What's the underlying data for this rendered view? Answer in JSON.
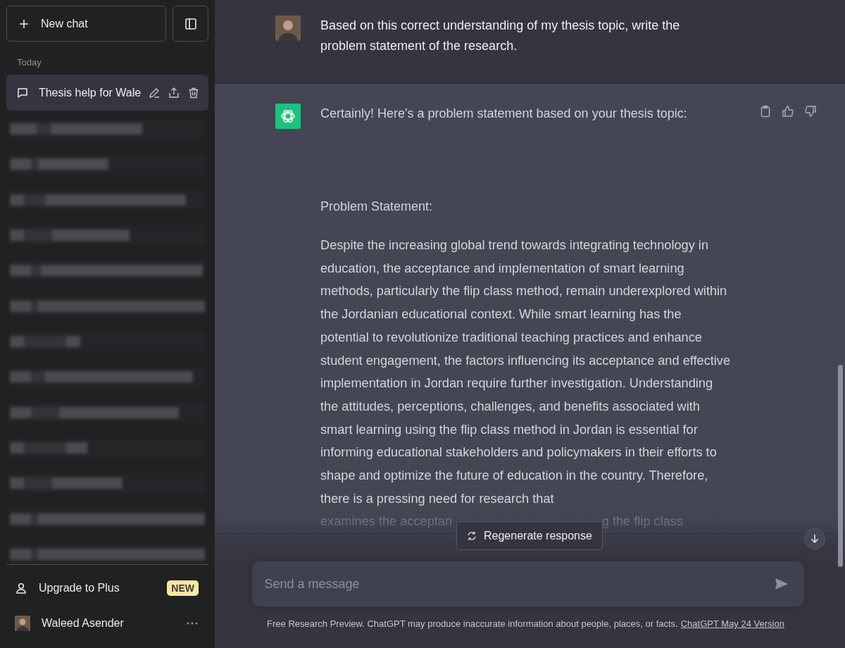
{
  "sidebar": {
    "new_chat_button": "New chat",
    "section_label": "Today",
    "conversations": [
      {
        "title": "Thesis help for Wale",
        "selected": true
      }
    ],
    "upgrade": {
      "label": "Upgrade to Plus",
      "badge": "NEW"
    },
    "user": {
      "name": "Waleed Asender"
    }
  },
  "messages": [
    {
      "kind": "user",
      "text": "Based on this correct understanding of my thesis topic, write the problem statement of the research."
    },
    {
      "kind": "assistant",
      "intro": "Certainly! Here's a problem statement based on your thesis topic:",
      "heading": "Problem Statement:",
      "paragraph": "Despite the increasing global trend towards integrating technology in education, the acceptance and implementation of smart learning methods, particularly the flip class method, remain underexplored within the Jordanian educational context. While smart learning has the potential to revolutionize traditional teaching practices and enhance student engagement, the factors influencing its acceptance and effective implementation in Jordan require further investigation. Understanding the attitudes, perceptions, challenges, and benefits associated with smart learning using the flip class method in Jordan is essential for informing educational stakeholders and policymakers in their efforts to shape and optimize the future of education in the country. Therefore, there is a pressing need for research that",
      "faded_fragments": [
        "examines the acceptan",
        "g the flip class"
      ]
    }
  ],
  "regenerate_button": "Regenerate response",
  "composer": {
    "placeholder": "Send a message"
  },
  "footer": {
    "text": "Free Research Preview. ChatGPT may produce inaccurate information about people, places, or facts.",
    "link": "ChatGPT May 24 Version"
  }
}
